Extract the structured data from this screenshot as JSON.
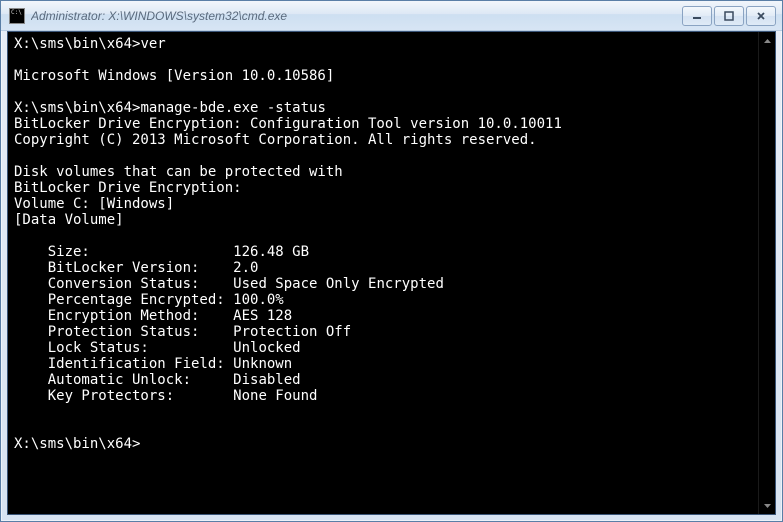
{
  "titlebar": {
    "title": "Administrator: X:\\WINDOWS\\system32\\cmd.exe"
  },
  "controls": {
    "minimize": "minimize",
    "maximize": "maximize",
    "close": "close"
  },
  "terminal": {
    "prompt1": "X:\\sms\\bin\\x64>",
    "cmd1": "ver",
    "blank": "",
    "ver_out": "Microsoft Windows [Version 10.0.10586]",
    "prompt2": "X:\\sms\\bin\\x64>",
    "cmd2": "manage-bde.exe -status",
    "tool_line": "BitLocker Drive Encryption: Configuration Tool version 10.0.10011",
    "copyright": "Copyright (C) 2013 Microsoft Corporation. All rights reserved.",
    "disk_line1": "Disk volumes that can be protected with",
    "disk_line2": "BitLocker Drive Encryption:",
    "vol_line": "Volume C: [Windows]",
    "data_vol": "[Data Volume]",
    "fields": {
      "size_label": "    Size:                 ",
      "size_val": "126.48 GB",
      "blver_label": "    BitLocker Version:    ",
      "blver_val": "2.0",
      "conv_label": "    Conversion Status:    ",
      "conv_val": "Used Space Only Encrypted",
      "pct_label": "    Percentage Encrypted: ",
      "pct_val": "100.0%",
      "enc_label": "    Encryption Method:    ",
      "enc_val": "AES 128",
      "prot_label": "    Protection Status:    ",
      "prot_val": "Protection Off",
      "lock_label": "    Lock Status:          ",
      "lock_val": "Unlocked",
      "id_label": "    Identification Field: ",
      "id_val": "Unknown",
      "auto_label": "    Automatic Unlock:     ",
      "auto_val": "Disabled",
      "key_label": "    Key Protectors:       ",
      "key_val": "None Found"
    },
    "prompt3": "X:\\sms\\bin\\x64>"
  }
}
